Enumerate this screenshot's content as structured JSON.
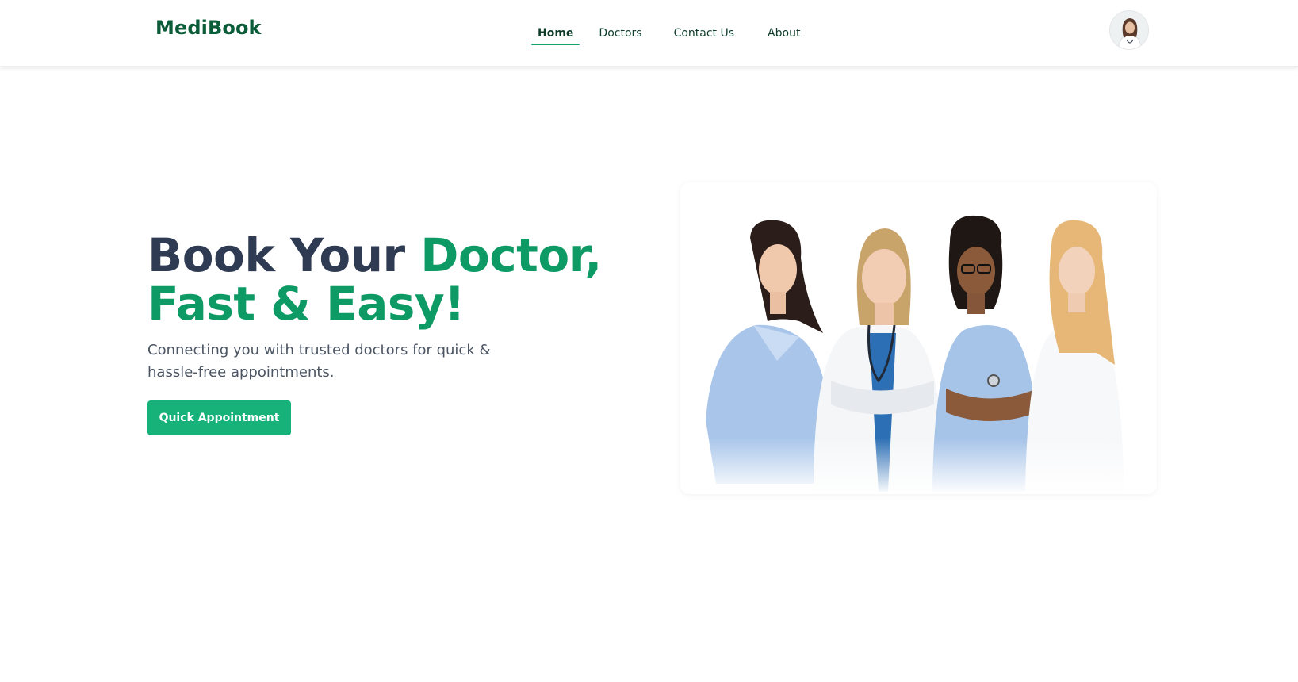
{
  "brand": {
    "name": "MediBook"
  },
  "nav": {
    "items": [
      {
        "label": "Home",
        "active": true
      },
      {
        "label": "Doctors",
        "active": false
      },
      {
        "label": "Contact Us",
        "active": false
      },
      {
        "label": "About",
        "active": false
      }
    ]
  },
  "user": {
    "avatar_icon": "user-avatar-photo"
  },
  "hero": {
    "title_part1": "Book Your ",
    "title_accent1": "Doctor,",
    "title_accent2": "Fast & Easy!",
    "subtitle": "Connecting you with trusted doctors for quick & hassle-free appointments.",
    "cta_label": "Quick Appointment",
    "image_icon": "doctors-team-photo"
  },
  "colors": {
    "brand_green": "#0b5d3a",
    "accent_green": "#0e9a64",
    "button_green": "#17b27a",
    "heading_dark": "#2f3b52"
  }
}
